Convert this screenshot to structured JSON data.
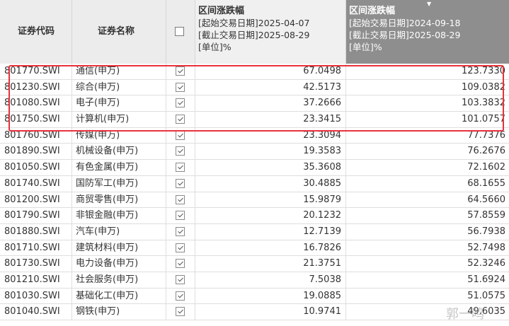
{
  "header": {
    "code_label": "证券代码",
    "name_label": "证券名称",
    "range1": {
      "title": "区间涨跌幅",
      "start": "[起始交易日期]2025-04-07",
      "end": "[截止交易日期]2025-08-29",
      "unit": "[单位]%"
    },
    "range2": {
      "title": "区间涨跌幅",
      "start": "[起始交易日期]2024-09-18",
      "end": "[截止交易日期]2025-08-29",
      "unit": "[单位]%"
    }
  },
  "rows": [
    {
      "code": "801770.SWI",
      "name": "通信(申万)",
      "r1": "67.0498",
      "r2": "123.7330"
    },
    {
      "code": "801230.SWI",
      "name": "综合(申万)",
      "r1": "42.5173",
      "r2": "109.0382"
    },
    {
      "code": "801080.SWI",
      "name": "电子(申万)",
      "r1": "37.2666",
      "r2": "103.3832"
    },
    {
      "code": "801750.SWI",
      "name": "计算机(申万)",
      "r1": "23.3415",
      "r2": "101.0757"
    },
    {
      "code": "801760.SWI",
      "name": "传媒(申万)",
      "r1": "23.3094",
      "r2": "77.7376"
    },
    {
      "code": "801890.SWI",
      "name": "机械设备(申万)",
      "r1": "19.3583",
      "r2": "76.2676"
    },
    {
      "code": "801050.SWI",
      "name": "有色金属(申万)",
      "r1": "35.3608",
      "r2": "72.1602"
    },
    {
      "code": "801740.SWI",
      "name": "国防军工(申万)",
      "r1": "30.4885",
      "r2": "68.1655"
    },
    {
      "code": "801200.SWI",
      "name": "商贸零售(申万)",
      "r1": "15.9879",
      "r2": "64.5660"
    },
    {
      "code": "801790.SWI",
      "name": "非银金融(申万)",
      "r1": "20.1232",
      "r2": "57.8559"
    },
    {
      "code": "801880.SWI",
      "name": "汽车(申万)",
      "r1": "12.7139",
      "r2": "56.7938"
    },
    {
      "code": "801710.SWI",
      "name": "建筑材料(申万)",
      "r1": "16.7826",
      "r2": "52.7498"
    },
    {
      "code": "801730.SWI",
      "name": "电力设备(申万)",
      "r1": "21.3751",
      "r2": "52.3246"
    },
    {
      "code": "801210.SWI",
      "name": "社会服务(申万)",
      "r1": "7.5038",
      "r2": "51.6924"
    },
    {
      "code": "801030.SWI",
      "name": "基础化工(申万)",
      "r1": "19.0885",
      "r2": "51.0575"
    },
    {
      "code": "801040.SWI",
      "name": "钢铁(申万)",
      "r1": "10.9741",
      "r2": "49.6035"
    }
  ],
  "watermark": "郭一鸣",
  "colors": {
    "highlight": "#e8323c",
    "sorted_header": "#8e8e8e",
    "header": "#ececec"
  }
}
